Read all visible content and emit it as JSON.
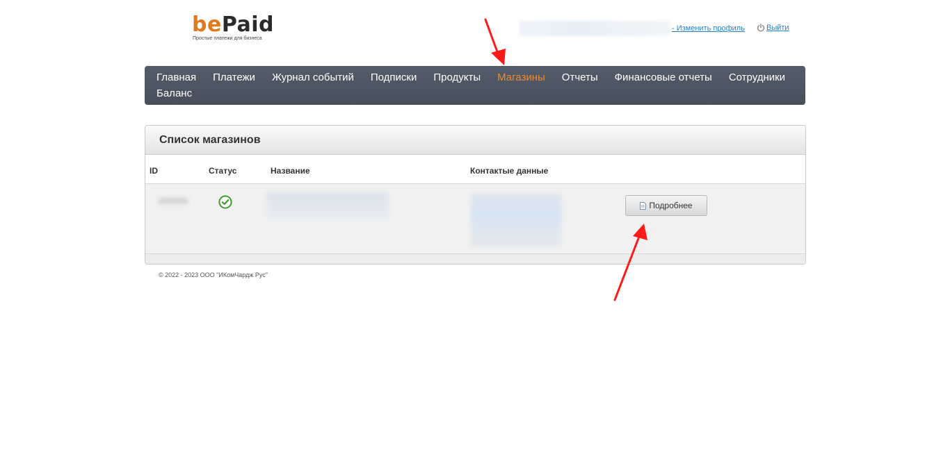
{
  "header": {
    "logo_be": "be",
    "logo_paid": "Paid",
    "logo_tagline": "Простые платежи для бизнеса",
    "edit_profile": "- Изменить профиль",
    "logout": "Выйти"
  },
  "nav": {
    "items": [
      {
        "label": "Главная"
      },
      {
        "label": "Платежи"
      },
      {
        "label": "Журнал событий"
      },
      {
        "label": "Подписки"
      },
      {
        "label": "Продукты"
      },
      {
        "label": "Магазины",
        "active": true
      },
      {
        "label": "Отчеты"
      },
      {
        "label": "Финансовые отчеты"
      },
      {
        "label": "Сотрудники"
      },
      {
        "label": "Баланс"
      }
    ],
    "active_color": "#f08a2c",
    "bg_color": "#4b5563"
  },
  "panel": {
    "title": "Список магазинов",
    "columns": {
      "id": "ID",
      "status": "Статус",
      "name": "Название",
      "contacts": "Контактые данные"
    },
    "rows": [
      {
        "status_icon": "check-circle-icon",
        "details_label": "Подробнее"
      }
    ]
  },
  "footer": {
    "copyright": "© 2022 - 2023 ООО \"ИКомЧардж Рус\""
  },
  "annotations": {
    "arrow_color": "#ff1a1a"
  }
}
